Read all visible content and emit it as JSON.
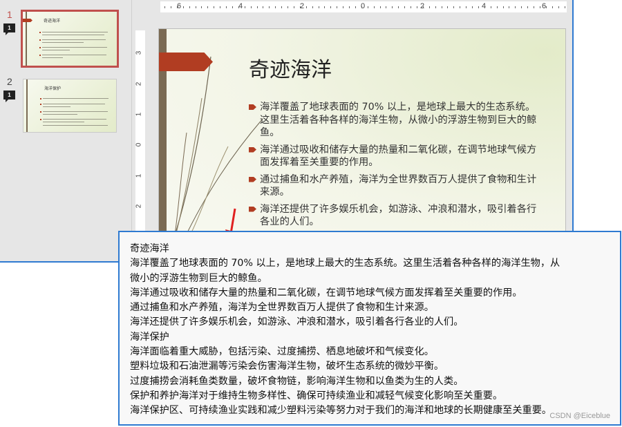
{
  "thumbnails": [
    {
      "number": "1",
      "comment_count": "1",
      "title": "奇迹海洋"
    },
    {
      "number": "2",
      "comment_count": "1",
      "title": "海洋保护"
    }
  ],
  "ruler": {
    "horizontal": [
      "6",
      "4",
      "2",
      "0",
      "2",
      "4",
      "6"
    ],
    "vertical": [
      "3",
      "2",
      "1",
      "0",
      "1",
      "2"
    ]
  },
  "slide": {
    "title": "奇迹海洋",
    "bullets": [
      "海洋覆盖了地球表面的 70% 以上，是地球上最大的生态系统。这里生活着各种各样的海洋生物，从微小的浮游生物到巨大的鲸鱼。",
      "海洋通过吸收和储存大量的热量和二氧化碳，在调节地球气候方面发挥着至关重要的作用。",
      "通过捕鱼和水产养殖，海洋为全世界数百万人提供了食物和生计来源。",
      "海洋还提供了许多娱乐机会，如游泳、冲浪和潜水，吸引着各行各业的人们。"
    ]
  },
  "callout": {
    "lines": [
      "奇迹海洋",
      "海洋覆盖了地球表面的 70% 以上，是地球上最大的生态系统。这里生活着各种各样的海洋生物，从",
      "微小的浮游生物到巨大的鲸鱼。",
      "海洋通过吸收和储存大量的热量和二氧化碳，在调节地球气候方面发挥着至关重要的作用。",
      "通过捕鱼和水产养殖，海洋为全世界数百万人提供了食物和生计来源。",
      "海洋还提供了许多娱乐机会，如游泳、冲浪和潜水，吸引着各行各业的人们。",
      "海洋保护",
      "海洋面临着重大威胁，包括污染、过度捕捞、栖息地破坏和气候变化。",
      "塑料垃圾和石油泄漏等污染会伤害海洋生物，破坏生态系统的微妙平衡。",
      "过度捕捞会消耗鱼类数量，破坏食物链，影响海洋生物和以鱼类为生的人类。",
      "保护和养护海洋对于维持生物多样性、确保可持续渔业和减轻气候变化影响至关重要。",
      "海洋保护区、可持续渔业实践和减少塑料污染等努力对于我们的海洋和地球的长期健康至关重要。"
    ],
    "watermark": "CSDN @Eiceblue"
  },
  "colors": {
    "accent": "#b13d22",
    "selection": "#c0504d",
    "frame": "#2e7ad1",
    "pointer": "#e02020"
  }
}
